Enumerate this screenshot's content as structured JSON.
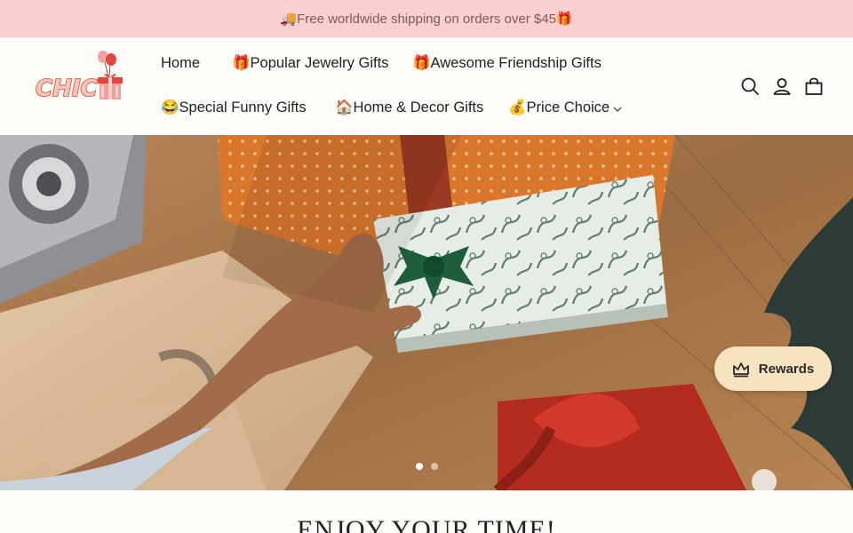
{
  "announcement": {
    "text": "🚚Free worldwide shipping on orders over $45🎁"
  },
  "header": {
    "logo_text": "CHIC",
    "nav": [
      {
        "label": "Home"
      },
      {
        "label": "🎁Popular Jewelry Gifts"
      },
      {
        "label": "🎁Awesome Friendship Gifts"
      },
      {
        "label": "😂Special Funny Gifts"
      },
      {
        "label": "🏠Home & Decor Gifts"
      },
      {
        "label": "💰Price Choice"
      }
    ],
    "icons": [
      "search-icon",
      "account-icon",
      "cart-icon"
    ]
  },
  "hero": {
    "slides": 2,
    "active_slide": 1
  },
  "rewards": {
    "label": "Rewards",
    "icon": "crown-icon"
  },
  "section": {
    "heading": "ENJOY YOUR TIME!"
  },
  "colors": {
    "announcement_bg": "#fbcfd0",
    "page_bg": "#fdfbf8",
    "rewards_bg": "#f8e3c1",
    "logo_red": "#e0483c"
  }
}
